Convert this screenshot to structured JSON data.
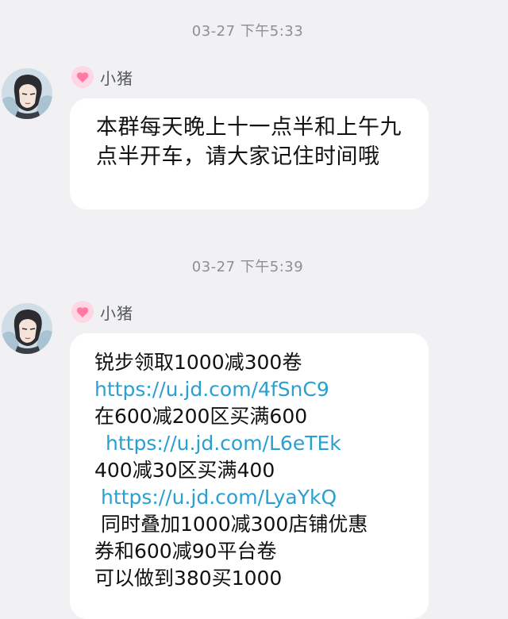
{
  "messages": [
    {
      "time": "03-27 下午5:33",
      "sender": "小猪",
      "text": "本群每天晚上十一点半和上午九点半开车，请大家记住时间哦"
    },
    {
      "time": "03-27 下午5:39",
      "sender": "小猪",
      "lines": [
        "锐步领取1000减300卷",
        "https://u.jd.com/4fSnC9",
        "在600减200区买满600",
        "https://u.jd.com/L6eTEk",
        "400减30区买满400",
        "https://u.jd.com/LyaYkQ",
        "同时叠加1000减300店铺优惠",
        "券和600减90平台卷",
        "可以做到380买1000"
      ]
    }
  ],
  "colors": {
    "background": "#f1f1f3",
    "bubble": "#ffffff",
    "link": "#2a9fd0",
    "timestamp": "#8e8e93",
    "heart_badge": "#ff7aa2"
  },
  "icons": {
    "sender_badge": "heart-icon",
    "avatar": "anime-character-avatar"
  }
}
